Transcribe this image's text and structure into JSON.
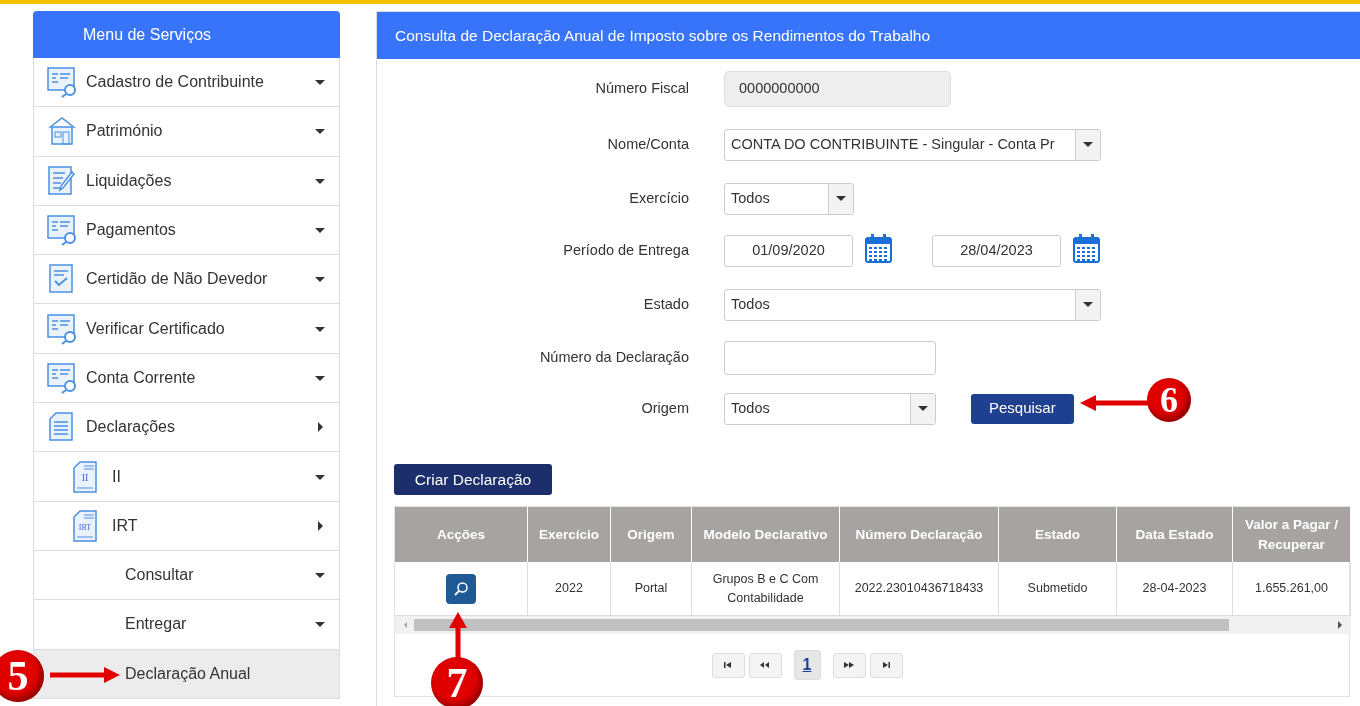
{
  "sidebar": {
    "title": "Menu de Serviços",
    "items": [
      {
        "label": "Cadastro de Contribuinte",
        "expanded": true,
        "selected": false
      },
      {
        "label": "Património",
        "expanded": true,
        "selected": false
      },
      {
        "label": "Liquidações",
        "expanded": true,
        "selected": false
      },
      {
        "label": "Pagamentos",
        "expanded": true,
        "selected": false
      },
      {
        "label": "Certidão de Não Devedor",
        "expanded": true,
        "selected": false
      },
      {
        "label": "Verificar Certificado",
        "expanded": true,
        "selected": false
      },
      {
        "label": "Conta Corrente",
        "expanded": true,
        "selected": false
      },
      {
        "label": "Declarações",
        "expanded": false,
        "selected": false,
        "children": [
          {
            "label": "II",
            "icon_text": "II",
            "expanded": true,
            "selected": false
          },
          {
            "label": "IRT",
            "icon_text": "IRT",
            "expanded": false,
            "selected": false,
            "children": [
              {
                "label": "Consultar",
                "expanded": true,
                "selected": false
              },
              {
                "label": "Entregar",
                "expanded": true,
                "selected": false
              },
              {
                "label": "Declaração Anual",
                "selected": true
              }
            ]
          }
        ]
      }
    ]
  },
  "panel": {
    "title": "Consulta de Declaração Anual de Imposto sobre os Rendimentos do Trabalho",
    "fields": [
      {
        "label": "Número Fiscal",
        "kind": "readonly",
        "value": "0000000000"
      },
      {
        "label": "Nome/Conta",
        "kind": "select",
        "value": "CONTA DO CONTRIBUINTE - Singular - Conta Pr"
      },
      {
        "label": "Exercício",
        "kind": "select",
        "value": "Todos"
      },
      {
        "label": "Período de Entrega",
        "kind": "daterange",
        "values": [
          "01/09/2020",
          "28/04/2023"
        ]
      },
      {
        "label": "Estado",
        "kind": "select",
        "value": "Todos"
      },
      {
        "label": "Número da Declaração",
        "kind": "text"
      },
      {
        "label": "Origem",
        "kind": "select",
        "value": "Todos"
      }
    ],
    "search_button": "Pesquisar",
    "create_button": "Criar Declaração",
    "table": {
      "columns": [
        "Acções",
        "Exercício",
        "Origem",
        "Modelo Declarativo",
        "Número Declaração",
        "Estado",
        "Data Estado",
        "Valor a Pagar / Recuperar"
      ],
      "rows": [
        {
          "cells": [
            "",
            "2022",
            "Portal",
            "Grupos B e C Com Contabilidade",
            "2022.23010436718433",
            "Submetido",
            "28-04-2023",
            "1.655.261,00"
          ]
        }
      ]
    },
    "pagination": {
      "pages": [
        {
          "label": "1",
          "selected": true
        }
      ]
    }
  },
  "callouts": [
    {
      "label": "5"
    },
    {
      "label": "6"
    },
    {
      "label": "7"
    }
  ]
}
